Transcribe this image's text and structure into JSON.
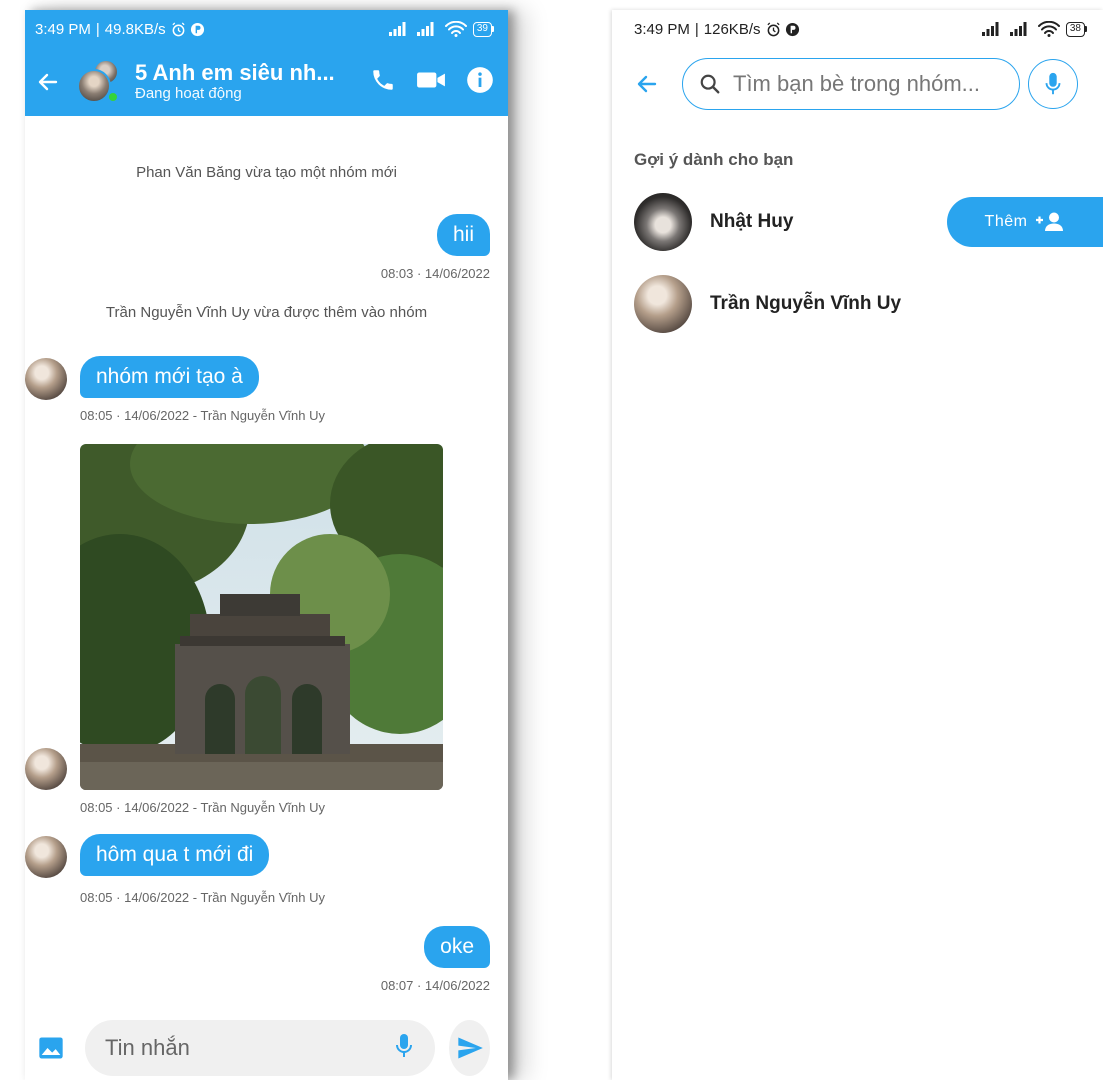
{
  "left": {
    "status": {
      "time": "3:49 PM",
      "speed": "49.8KB/s",
      "battery": "39"
    },
    "header": {
      "title": "5 Anh em siêu nh...",
      "subtitle": "Đang hoạt động"
    },
    "messages": [
      {
        "type": "system",
        "text": "Phan Văn Băng vừa tạo một nhóm mới"
      },
      {
        "type": "out",
        "text": "hii",
        "meta": "08:03 · 14/06/2022"
      },
      {
        "type": "system",
        "text": "Trần Nguyễn Vĩnh Uy vừa được thêm vào nhóm"
      },
      {
        "type": "in",
        "text": "nhóm mới tạo à",
        "meta": "08:05 · 14/06/2022 - Trần Nguyễn Vĩnh Uy"
      },
      {
        "type": "in-image",
        "meta": "08:05 · 14/06/2022 - Trần Nguyễn Vĩnh Uy"
      },
      {
        "type": "in",
        "text": "hôm qua t mới đi",
        "meta": "08:05 · 14/06/2022 - Trần Nguyễn Vĩnh Uy"
      },
      {
        "type": "out",
        "text": "oke",
        "meta": "08:07 · 14/06/2022"
      }
    ],
    "composer": {
      "placeholder": "Tin nhắn"
    }
  },
  "right": {
    "status": {
      "time": "3:49 PM",
      "speed": "126KB/s",
      "battery": "38"
    },
    "search": {
      "placeholder": "Tìm bạn bè trong nhóm..."
    },
    "section_title": "Gợi ý dành cho bạn",
    "users": [
      {
        "name": "Nhật Huy",
        "action": "Thêm"
      },
      {
        "name": "Trần Nguyễn Vĩnh Uy"
      }
    ]
  },
  "colors": {
    "accent": "#2aa4ee",
    "online": "#35d33a"
  },
  "icons": [
    "back-arrow-icon",
    "phone-icon",
    "video-icon",
    "info-icon",
    "gallery-icon",
    "mic-icon",
    "send-icon",
    "search-icon",
    "add-user-icon",
    "alarm-icon",
    "signal-icon",
    "wifi-icon",
    "battery-icon"
  ]
}
